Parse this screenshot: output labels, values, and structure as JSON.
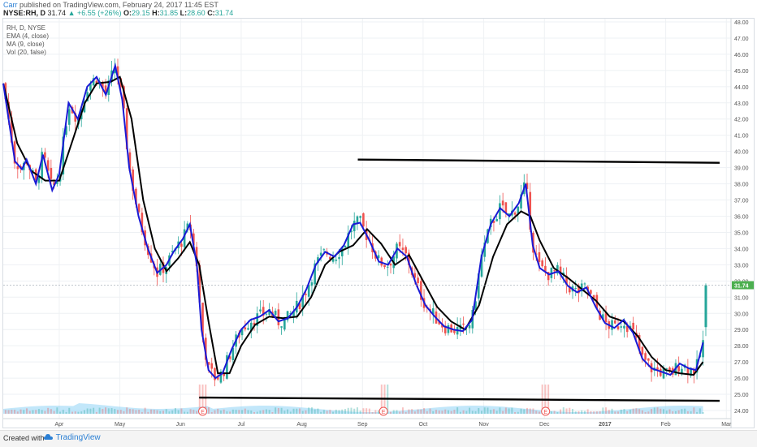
{
  "header": {
    "author": "Carr",
    "published_text": "published on TradingView.com, February 24, 2017 11:45 EST",
    "symbol": "NYSE:RH, D",
    "last": "31.74",
    "change": "▲ +6.55 (+26%)",
    "open_label": "O:",
    "open": "29.15",
    "high_label": "H:",
    "high": "31.85",
    "low_label": "L:",
    "low": "28.60",
    "close_label": "C:",
    "close": "31.74"
  },
  "legend": {
    "title": "RH, D, NYSE",
    "ema": "EMA (4, close)",
    "ma": "MA (9, close)",
    "vol": "Vol (20, false)"
  },
  "footer": {
    "created_with": "Created with",
    "brand": "TradingView"
  },
  "colors": {
    "up": "#26a69a",
    "down": "#ef5350",
    "ema": "#1a1ad6",
    "ma": "#000000",
    "volume_ma": "#8fd3f5",
    "price_badge": "#4caf50"
  },
  "chart_data": {
    "type": "candlestick",
    "x_ticks": [
      "Apr",
      "May",
      "Jun",
      "Jul",
      "Aug",
      "Sep",
      "Oct",
      "Nov",
      "Dec",
      "2017",
      "Feb",
      "Mar"
    ],
    "y_ticks": [
      "24.00",
      "25.00",
      "26.00",
      "27.00",
      "28.00",
      "29.00",
      "30.00",
      "31.00",
      "32.00",
      "33.00",
      "34.00",
      "35.00",
      "36.00",
      "37.00",
      "38.00",
      "39.00",
      "40.00",
      "41.00",
      "42.00",
      "43.00",
      "44.00",
      "45.00",
      "46.00",
      "47.00",
      "48.00"
    ],
    "ylim": [
      23.5,
      48.2
    ],
    "last_price_label": "31.74",
    "earnings_marker": "E",
    "price_path": [
      {
        "t": 0.0,
        "p": 44.2
      },
      {
        "t": 0.5,
        "p": 39.4
      },
      {
        "t": 0.8,
        "p": 38.9
      },
      {
        "t": 1.0,
        "p": 39.5
      },
      {
        "t": 1.4,
        "p": 38.0
      },
      {
        "t": 1.7,
        "p": 39.8
      },
      {
        "t": 2.1,
        "p": 37.6
      },
      {
        "t": 2.4,
        "p": 38.6
      },
      {
        "t": 2.8,
        "p": 43.0
      },
      {
        "t": 3.2,
        "p": 42.0
      },
      {
        "t": 3.6,
        "p": 44.0
      },
      {
        "t": 4.0,
        "p": 44.6
      },
      {
        "t": 4.4,
        "p": 43.5
      },
      {
        "t": 4.8,
        "p": 45.3
      },
      {
        "t": 5.1,
        "p": 43.2
      },
      {
        "t": 5.4,
        "p": 39.0
      },
      {
        "t": 5.8,
        "p": 36.0
      },
      {
        "t": 6.2,
        "p": 34.0
      },
      {
        "t": 6.6,
        "p": 32.5
      },
      {
        "t": 7.0,
        "p": 33.0
      },
      {
        "t": 7.3,
        "p": 33.8
      },
      {
        "t": 7.7,
        "p": 34.6
      },
      {
        "t": 8.0,
        "p": 35.5
      },
      {
        "t": 8.3,
        "p": 33.0
      },
      {
        "t": 8.5,
        "p": 29.0
      },
      {
        "t": 8.8,
        "p": 26.5
      },
      {
        "t": 9.1,
        "p": 26.0
      },
      {
        "t": 9.4,
        "p": 26.3
      },
      {
        "t": 9.8,
        "p": 27.8
      },
      {
        "t": 10.2,
        "p": 29.0
      },
      {
        "t": 10.6,
        "p": 29.6
      },
      {
        "t": 11.0,
        "p": 29.8
      },
      {
        "t": 11.4,
        "p": 30.2
      },
      {
        "t": 11.8,
        "p": 29.5
      },
      {
        "t": 12.2,
        "p": 29.7
      },
      {
        "t": 12.6,
        "p": 30.4
      },
      {
        "t": 13.0,
        "p": 31.5
      },
      {
        "t": 13.4,
        "p": 33.0
      },
      {
        "t": 13.8,
        "p": 33.8
      },
      {
        "t": 14.2,
        "p": 33.5
      },
      {
        "t": 14.6,
        "p": 34.2
      },
      {
        "t": 15.0,
        "p": 35.5
      },
      {
        "t": 15.3,
        "p": 35.6
      },
      {
        "t": 15.7,
        "p": 34.5
      },
      {
        "t": 16.1,
        "p": 33.2
      },
      {
        "t": 16.5,
        "p": 33.0
      },
      {
        "t": 16.9,
        "p": 34.0
      },
      {
        "t": 17.3,
        "p": 33.5
      },
      {
        "t": 17.7,
        "p": 31.8
      },
      {
        "t": 18.1,
        "p": 30.5
      },
      {
        "t": 18.5,
        "p": 29.8
      },
      {
        "t": 18.9,
        "p": 29.2
      },
      {
        "t": 19.3,
        "p": 29.0
      },
      {
        "t": 19.7,
        "p": 28.9
      },
      {
        "t": 20.1,
        "p": 29.6
      },
      {
        "t": 20.5,
        "p": 33.5
      },
      {
        "t": 20.9,
        "p": 35.5
      },
      {
        "t": 21.3,
        "p": 36.5
      },
      {
        "t": 21.7,
        "p": 36.0
      },
      {
        "t": 22.1,
        "p": 36.8
      },
      {
        "t": 22.4,
        "p": 38.0
      },
      {
        "t": 22.7,
        "p": 34.2
      },
      {
        "t": 23.0,
        "p": 32.8
      },
      {
        "t": 23.4,
        "p": 32.4
      },
      {
        "t": 23.8,
        "p": 32.6
      },
      {
        "t": 24.2,
        "p": 31.7
      },
      {
        "t": 24.6,
        "p": 31.3
      },
      {
        "t": 25.0,
        "p": 31.6
      },
      {
        "t": 25.4,
        "p": 30.4
      },
      {
        "t": 25.8,
        "p": 29.4
      },
      {
        "t": 26.2,
        "p": 29.1
      },
      {
        "t": 26.6,
        "p": 29.6
      },
      {
        "t": 27.0,
        "p": 28.8
      },
      {
        "t": 27.4,
        "p": 27.2
      },
      {
        "t": 27.8,
        "p": 26.6
      },
      {
        "t": 28.2,
        "p": 26.4
      },
      {
        "t": 28.6,
        "p": 26.2
      },
      {
        "t": 29.0,
        "p": 26.9
      },
      {
        "t": 29.4,
        "p": 26.6
      },
      {
        "t": 29.7,
        "p": 26.5
      },
      {
        "t": 30.0,
        "p": 28.2
      }
    ],
    "ma_path": [
      {
        "t": 0.0,
        "p": 44.2
      },
      {
        "t": 0.6,
        "p": 40.5
      },
      {
        "t": 1.2,
        "p": 38.8
      },
      {
        "t": 1.8,
        "p": 38.2
      },
      {
        "t": 2.4,
        "p": 38.2
      },
      {
        "t": 3.0,
        "p": 40.8
      },
      {
        "t": 3.5,
        "p": 43.0
      },
      {
        "t": 4.0,
        "p": 44.2
      },
      {
        "t": 4.6,
        "p": 44.3
      },
      {
        "t": 5.0,
        "p": 44.6
      },
      {
        "t": 5.5,
        "p": 42.0
      },
      {
        "t": 6.0,
        "p": 37.0
      },
      {
        "t": 6.5,
        "p": 34.0
      },
      {
        "t": 7.0,
        "p": 32.6
      },
      {
        "t": 7.5,
        "p": 33.4
      },
      {
        "t": 8.0,
        "p": 34.4
      },
      {
        "t": 8.4,
        "p": 33.0
      },
      {
        "t": 8.8,
        "p": 29.5
      },
      {
        "t": 9.2,
        "p": 26.3
      },
      {
        "t": 9.7,
        "p": 26.3
      },
      {
        "t": 10.2,
        "p": 28.0
      },
      {
        "t": 10.8,
        "p": 29.3
      },
      {
        "t": 11.4,
        "p": 29.8
      },
      {
        "t": 12.0,
        "p": 29.7
      },
      {
        "t": 12.6,
        "p": 29.8
      },
      {
        "t": 13.2,
        "p": 31.0
      },
      {
        "t": 13.8,
        "p": 33.0
      },
      {
        "t": 14.4,
        "p": 33.8
      },
      {
        "t": 15.0,
        "p": 34.2
      },
      {
        "t": 15.6,
        "p": 35.2
      },
      {
        "t": 16.2,
        "p": 34.3
      },
      {
        "t": 16.8,
        "p": 33.0
      },
      {
        "t": 17.4,
        "p": 33.6
      },
      {
        "t": 18.0,
        "p": 32.0
      },
      {
        "t": 18.6,
        "p": 30.4
      },
      {
        "t": 19.2,
        "p": 29.5
      },
      {
        "t": 19.8,
        "p": 29.0
      },
      {
        "t": 20.4,
        "p": 30.5
      },
      {
        "t": 21.0,
        "p": 33.5
      },
      {
        "t": 21.6,
        "p": 35.5
      },
      {
        "t": 22.2,
        "p": 36.3
      },
      {
        "t": 22.6,
        "p": 36.0
      },
      {
        "t": 23.0,
        "p": 34.5
      },
      {
        "t": 23.6,
        "p": 32.8
      },
      {
        "t": 24.2,
        "p": 32.2
      },
      {
        "t": 24.8,
        "p": 31.5
      },
      {
        "t": 25.4,
        "p": 30.8
      },
      {
        "t": 26.0,
        "p": 29.8
      },
      {
        "t": 26.6,
        "p": 29.5
      },
      {
        "t": 27.2,
        "p": 28.6
      },
      {
        "t": 27.8,
        "p": 27.3
      },
      {
        "t": 28.4,
        "p": 26.5
      },
      {
        "t": 29.0,
        "p": 26.3
      },
      {
        "t": 29.6,
        "p": 26.2
      },
      {
        "t": 30.0,
        "p": 27.0
      }
    ],
    "resistance": [
      {
        "t": 15.2,
        "p": 39.5
      },
      {
        "t": 31.2,
        "p": 39.3
      }
    ],
    "support": [
      {
        "t": 8.4,
        "p": 24.8
      },
      {
        "t": 31.2,
        "p": 24.6
      }
    ],
    "earnings_t": [
      8.55,
      16.3,
      23.25
    ]
  }
}
